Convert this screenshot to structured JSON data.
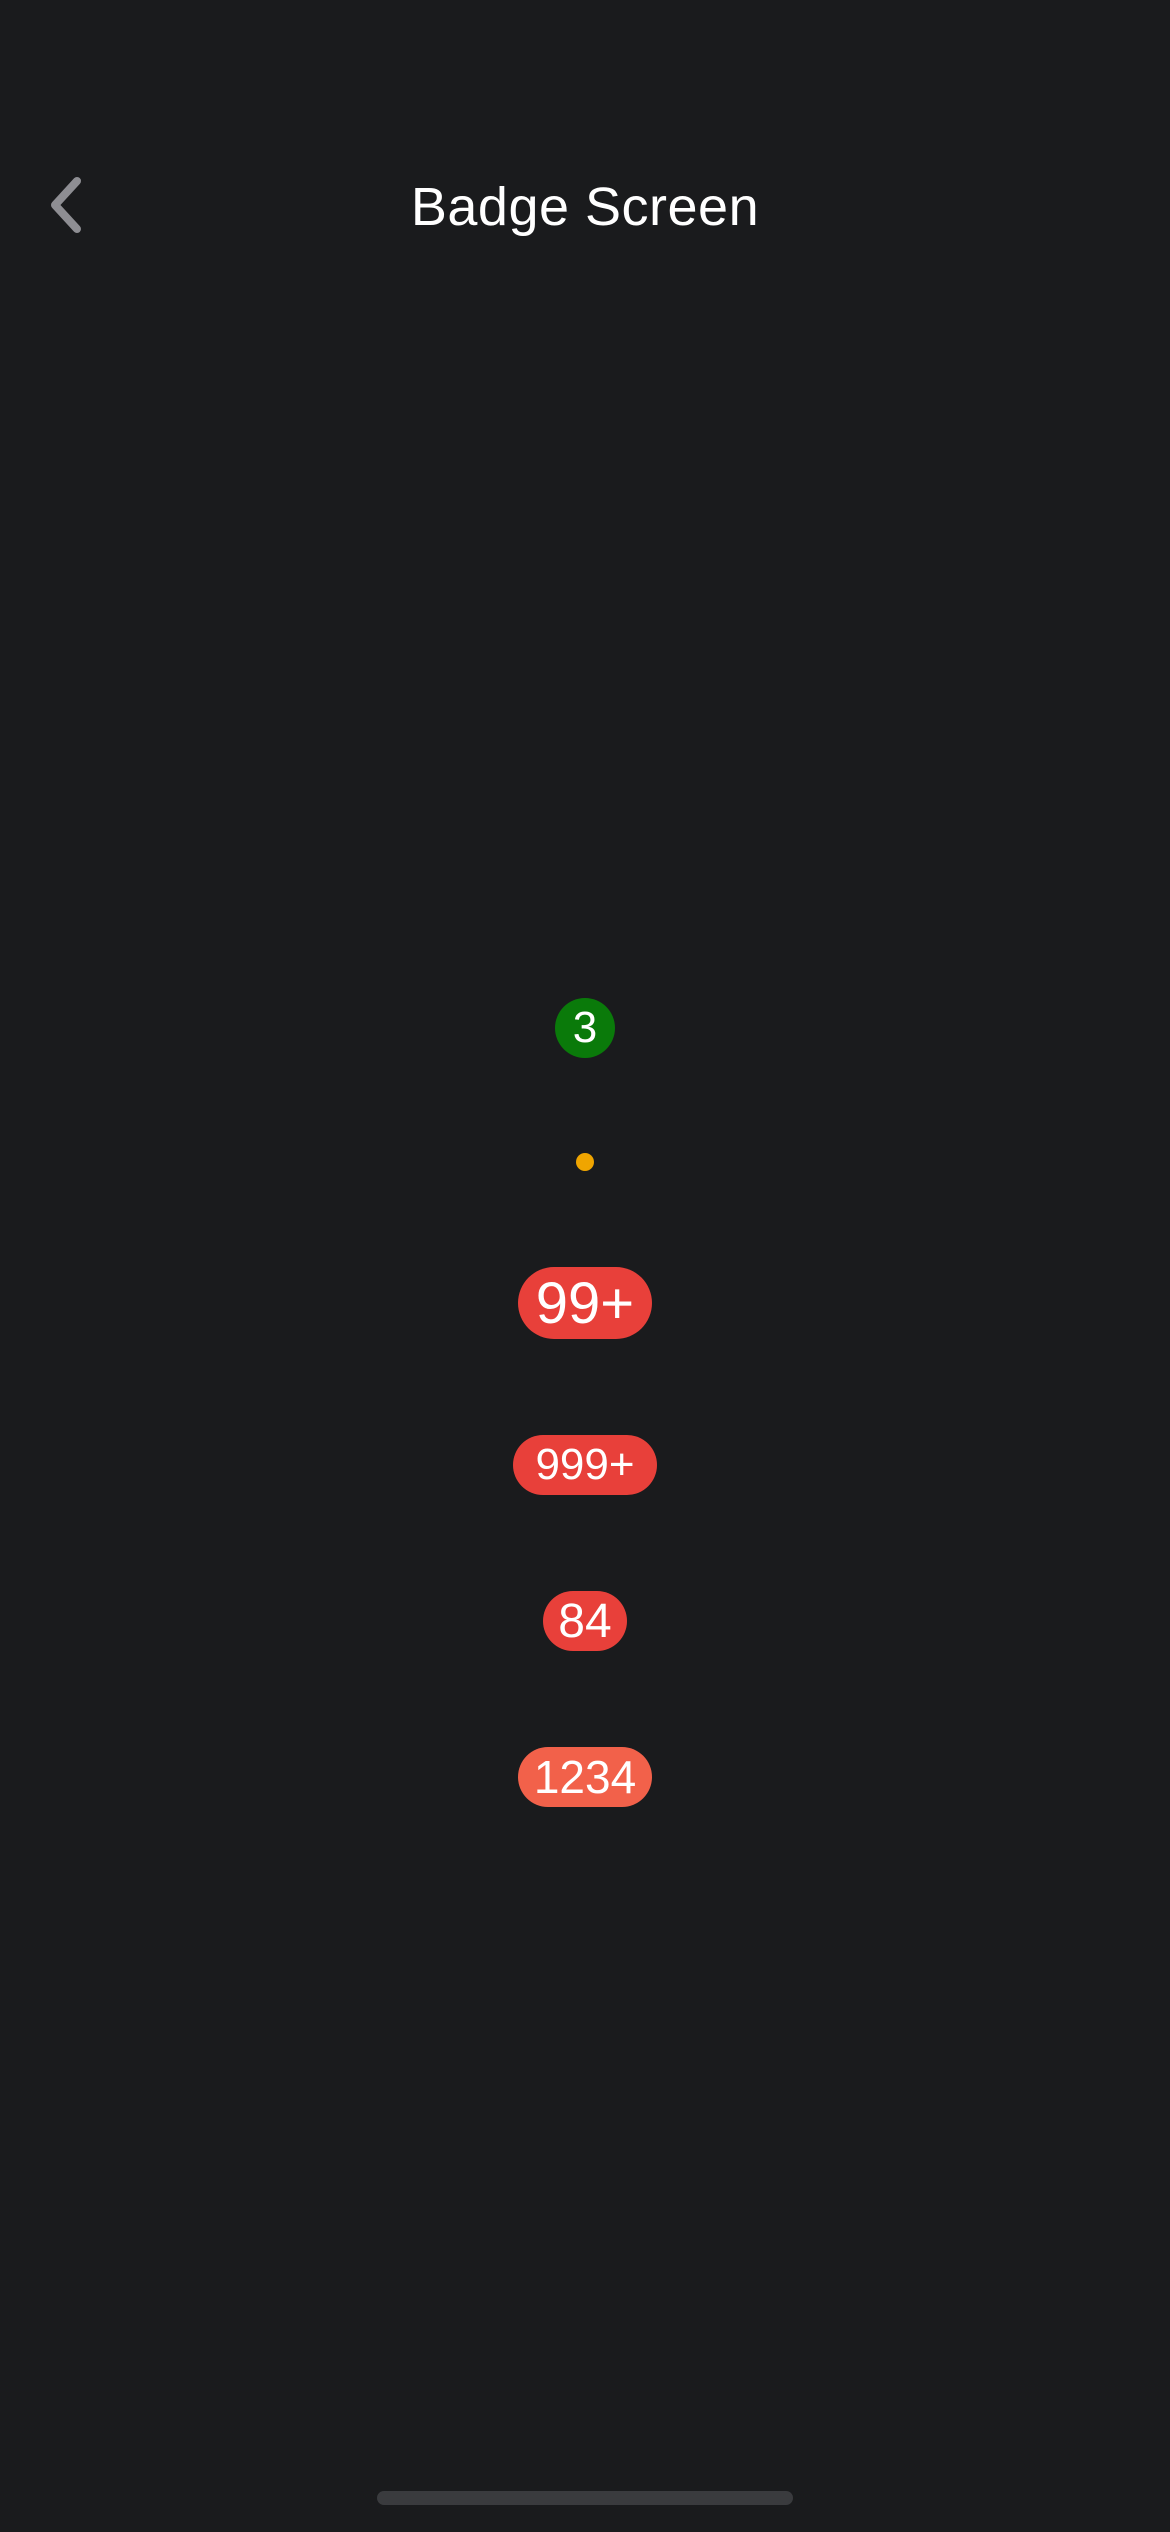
{
  "header": {
    "title": "Badge Screen",
    "back_icon": "chevron-left-icon"
  },
  "badges": [
    {
      "label": "3",
      "color": "#0a7a0a",
      "kind": "number"
    },
    {
      "label": "",
      "color": "#f0a500",
      "kind": "dot"
    },
    {
      "label": "99+",
      "color": "#e8403a",
      "kind": "number"
    },
    {
      "label": "999+",
      "color": "#e8403a",
      "kind": "number"
    },
    {
      "label": "84",
      "color": "#e8403a",
      "kind": "number"
    },
    {
      "label": "1234",
      "color": "#f2614a",
      "kind": "number"
    }
  ],
  "colors": {
    "background": "#1a1b1d",
    "text": "#ffffff",
    "home_indicator": "#3a3b3e"
  }
}
